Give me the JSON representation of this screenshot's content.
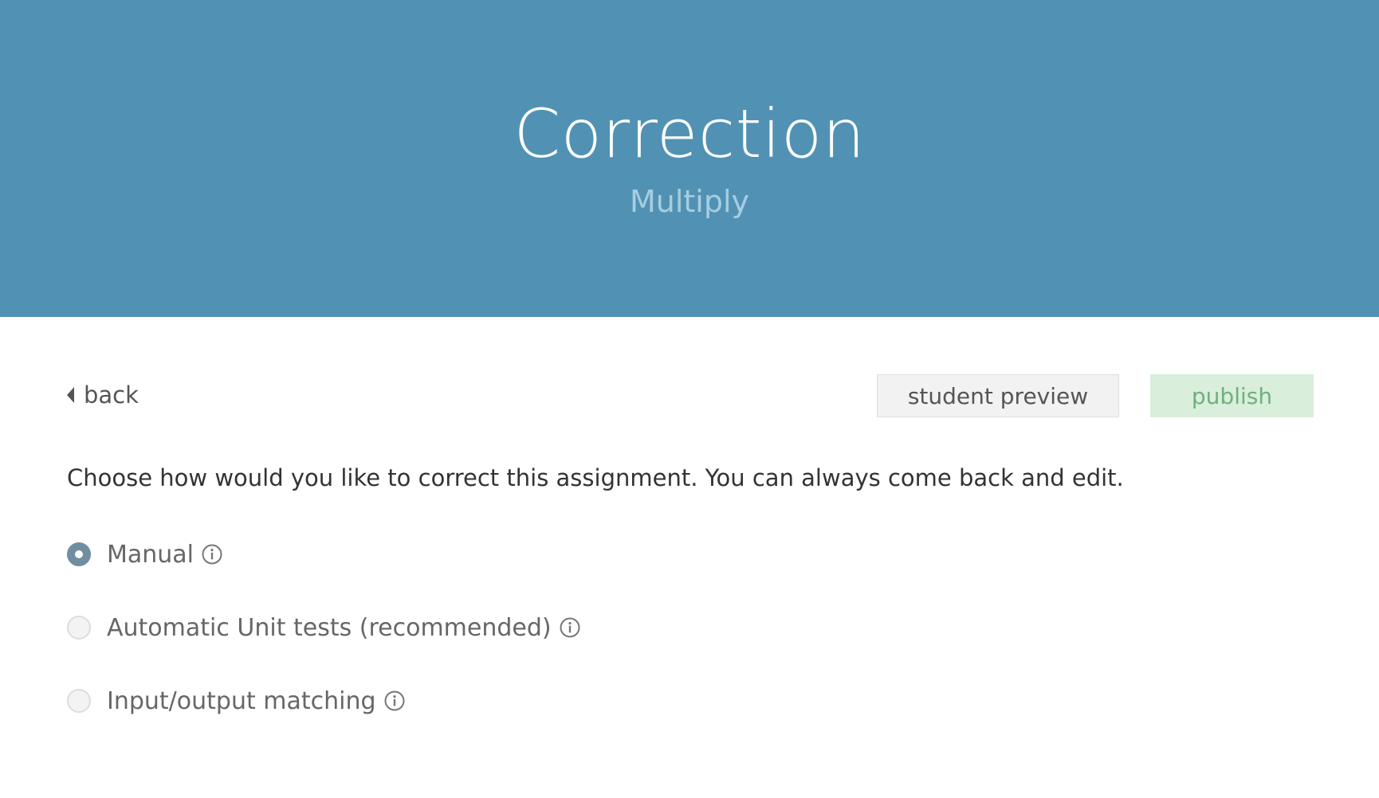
{
  "header": {
    "title": "Correction",
    "subtitle": "Multiply"
  },
  "toolbar": {
    "back_label": "back",
    "preview_label": "student preview",
    "publish_label": "publish"
  },
  "instructions": "Choose how would you like to correct this assignment. You can always come back and edit.",
  "options": [
    {
      "label": "Manual",
      "selected": true
    },
    {
      "label": "Automatic Unit tests (recommended)",
      "selected": false
    },
    {
      "label": "Input/output matching",
      "selected": false
    }
  ],
  "colors": {
    "header_bg": "#5192b4",
    "subtitle": "#a7cde0",
    "publish_bg": "#d9eedb",
    "publish_text": "#6fb07e",
    "radio_selected": "#6f8ea2"
  }
}
